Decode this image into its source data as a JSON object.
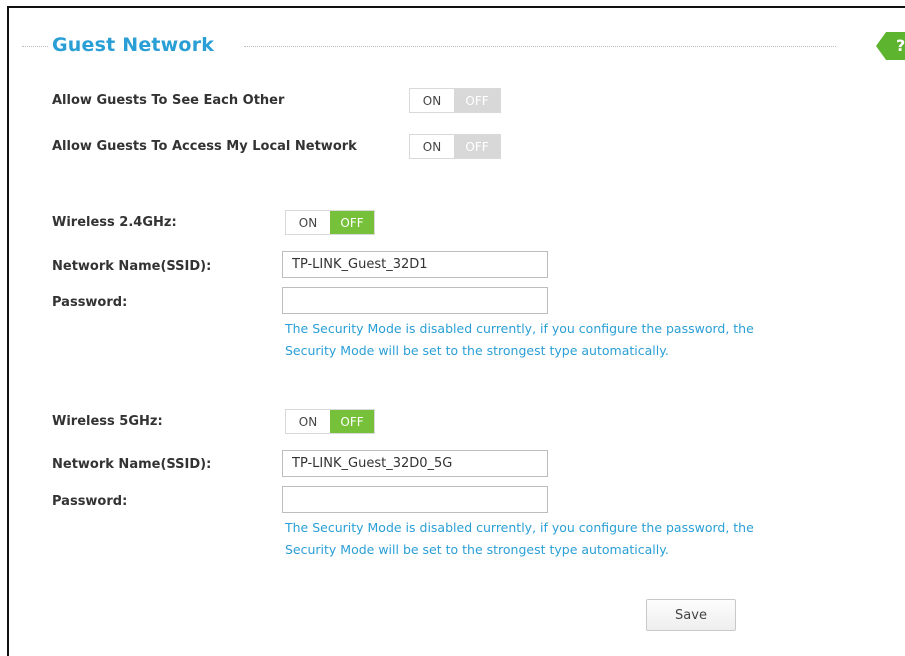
{
  "section": {
    "title": "Guest Network",
    "help_icon_text": "?"
  },
  "guest_options": {
    "see_each_other": {
      "label": "Allow Guests To See Each Other",
      "on": "ON",
      "off": "OFF",
      "state": "on"
    },
    "local_network": {
      "label": "Allow Guests To Access My Local Network",
      "on": "ON",
      "off": "OFF",
      "state": "on"
    }
  },
  "wireless_24": {
    "label": "Wireless 2.4GHz:",
    "toggle": {
      "on": "ON",
      "off": "OFF",
      "state": "off"
    },
    "ssid_label": "Network Name(SSID):",
    "ssid_value": "TP-LINK_Guest_32D1",
    "password_label": "Password:",
    "password_value": "",
    "note_line1": "The Security Mode is disabled currently, if you configure the password, the",
    "note_line2": "Security Mode will be set to the strongest type automatically."
  },
  "wireless_5": {
    "label": "Wireless 5GHz:",
    "toggle": {
      "on": "ON",
      "off": "OFF",
      "state": "off"
    },
    "ssid_label": "Network Name(SSID):",
    "ssid_value": "TP-LINK_Guest_32D0_5G",
    "password_label": "Password:",
    "password_value": "",
    "note_line1": "The Security Mode is disabled currently, if you configure the password, the",
    "note_line2": "Security Mode will be set to the strongest type automatically."
  },
  "actions": {
    "save_label": "Save"
  },
  "colors": {
    "accent_blue": "#2a9fd6",
    "toggle_green": "#77c13a",
    "help_green": "#5db42f"
  }
}
